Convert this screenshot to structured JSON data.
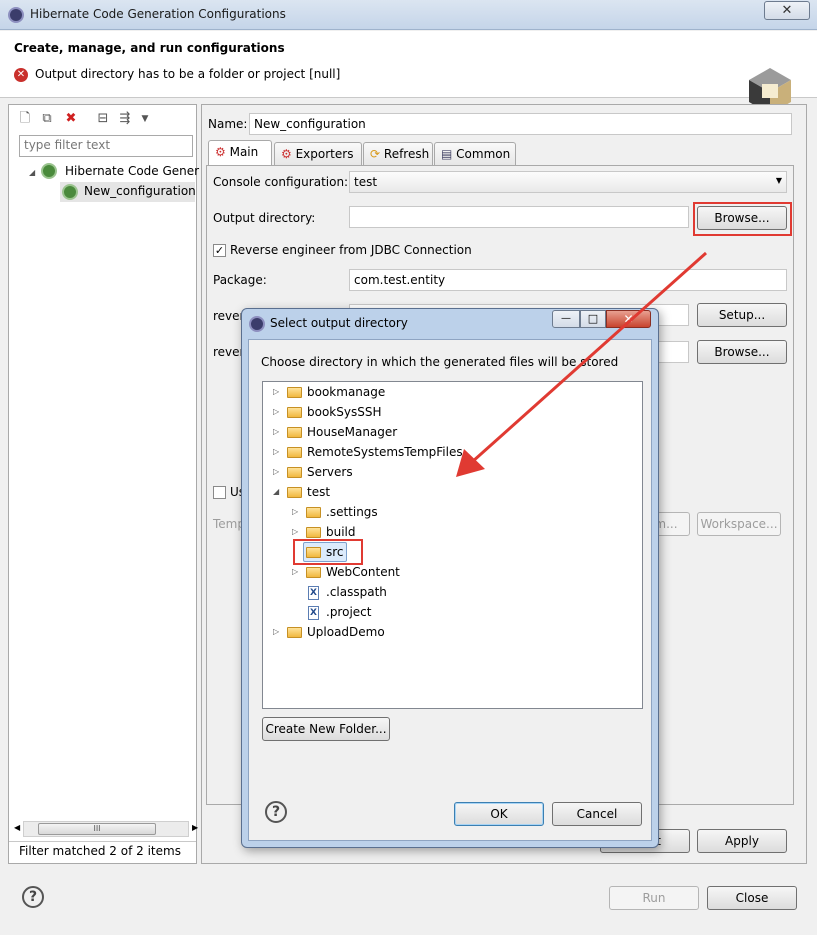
{
  "window": {
    "title": "Hibernate Code Generation Configurations",
    "close_glyph": "✕"
  },
  "header": {
    "title": "Create, manage, and run configurations",
    "error_message": "Output directory has to be a folder or project [null]"
  },
  "left_panel": {
    "filter_placeholder": "type filter text",
    "tree": [
      {
        "label": "Hibernate Code Gener",
        "expanded": true
      },
      {
        "label": "New_configuration",
        "selected": true
      }
    ],
    "scroll_glyph": "III",
    "status": "Filter matched 2 of 2 items"
  },
  "main": {
    "name_label": "Name:",
    "name_value": "New_configuration",
    "tabs": [
      {
        "label": "Main",
        "active": true,
        "icon": "main-tab-icon"
      },
      {
        "label": "Exporters",
        "icon": "exporters-tab-icon"
      },
      {
        "label": "Refresh",
        "icon": "refresh-tab-icon"
      },
      {
        "label": "Common",
        "icon": "common-tab-icon"
      }
    ],
    "console_config_label": "Console configuration:",
    "console_config_value": "test",
    "output_dir_label": "Output directory:",
    "output_dir_value": "",
    "browse_label": "Browse...",
    "reverse_engineer_label": "Reverse engineer from JDBC Connection",
    "reverse_engineer_checked": true,
    "package_label": "Package:",
    "package_value": "com.test.entity",
    "reveng_label_1": "rever",
    "reveng_label_2": "rever",
    "setup_label": "Setup...",
    "browse2_label": "Browse...",
    "use_label": "Us",
    "template_label": "Temp",
    "filesystem_label": "m...",
    "workspace_label": "Workspace...",
    "revert_partial": "t",
    "apply_label": "Apply"
  },
  "footer": {
    "run_label": "Run",
    "close_label": "Close"
  },
  "dialog": {
    "title": "Select output directory",
    "instruction": "Choose directory in which the generated files will be stored",
    "tree": [
      {
        "label": "bookmanage",
        "level": 0,
        "expander": "▷",
        "kind": "folder"
      },
      {
        "label": "bookSysSSH",
        "level": 0,
        "expander": "▷",
        "kind": "folder"
      },
      {
        "label": "HouseManager",
        "level": 0,
        "expander": "▷",
        "kind": "folder"
      },
      {
        "label": "RemoteSystemsTempFiles",
        "level": 0,
        "expander": "▷",
        "kind": "folder"
      },
      {
        "label": "Servers",
        "level": 0,
        "expander": "▷",
        "kind": "folder"
      },
      {
        "label": "test",
        "level": 0,
        "expander": "◢",
        "kind": "folder"
      },
      {
        "label": ".settings",
        "level": 1,
        "expander": "▷",
        "kind": "folder"
      },
      {
        "label": "build",
        "level": 1,
        "expander": "▷",
        "kind": "folder"
      },
      {
        "label": "src",
        "level": 1,
        "expander": "",
        "kind": "folder",
        "selected": true
      },
      {
        "label": "WebContent",
        "level": 1,
        "expander": "▷",
        "kind": "folder"
      },
      {
        "label": ".classpath",
        "level": 1,
        "expander": "",
        "kind": "xfile"
      },
      {
        "label": ".project",
        "level": 1,
        "expander": "",
        "kind": "xfile"
      },
      {
        "label": "UploadDemo",
        "level": 0,
        "expander": "▷",
        "kind": "folder"
      }
    ],
    "new_folder_label": "Create New Folder...",
    "ok_label": "OK",
    "cancel_label": "Cancel",
    "help_glyph": "?",
    "minimize_glyph": "—",
    "maximize_glyph": "□",
    "close_glyph": "✕"
  },
  "annotation_color": "#e03a32"
}
